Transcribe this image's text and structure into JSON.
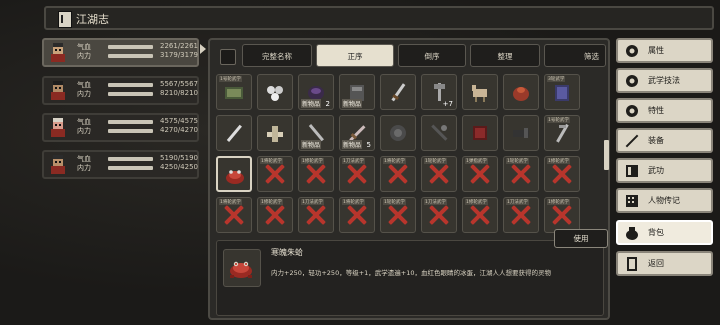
{
  "title": "江湖志",
  "party": [
    {
      "hp_label": "气血",
      "mp_label": "内力",
      "hp": "2261/2261",
      "mp": "3179/3179",
      "hp_frac": 1.0,
      "mp_frac": 1.0,
      "selected": true
    },
    {
      "hp_label": "气血",
      "mp_label": "内力",
      "hp": "5567/5567",
      "mp": "8210/8210",
      "hp_frac": 1.0,
      "mp_frac": 1.0,
      "selected": false
    },
    {
      "hp_label": "气血",
      "mp_label": "内力",
      "hp": "4575/4575",
      "mp": "4270/4270",
      "hp_frac": 1.0,
      "mp_frac": 1.0,
      "selected": false
    },
    {
      "hp_label": "气血",
      "mp_label": "内力",
      "hp": "5190/5190",
      "mp": "4250/4250",
      "hp_frac": 1.0,
      "mp_frac": 1.0,
      "selected": false
    }
  ],
  "toolbar": {
    "complete_name": "完整名称",
    "tabs": [
      "正序",
      "倒序",
      "整理",
      "筛选"
    ],
    "active_tab": 0
  },
  "inventory": {
    "row1": [
      {
        "tag": "1号轮武学",
        "count": "",
        "new": ""
      },
      {
        "tag": "",
        "count": "",
        "new": ""
      },
      {
        "tag": "",
        "count": "2",
        "new": "新物品"
      },
      {
        "tag": "",
        "count": "",
        "new": "新物品"
      },
      {
        "tag": "",
        "count": "",
        "new": ""
      },
      {
        "tag": "",
        "count": "+7",
        "new": ""
      },
      {
        "tag": "",
        "count": "",
        "new": ""
      },
      {
        "tag": "",
        "count": "",
        "new": ""
      },
      {
        "tag": "3轮武学",
        "count": "",
        "new": ""
      }
    ],
    "row2": [
      {
        "tag": "",
        "count": "",
        "new": ""
      },
      {
        "tag": "",
        "count": "",
        "new": ""
      },
      {
        "tag": "",
        "count": "",
        "new": "新物品"
      },
      {
        "tag": "",
        "count": "5",
        "new": "新物品"
      },
      {
        "tag": "",
        "count": "",
        "new": ""
      },
      {
        "tag": "",
        "count": "",
        "new": ""
      },
      {
        "tag": "",
        "count": "",
        "new": ""
      },
      {
        "tag": "",
        "count": "",
        "new": ""
      },
      {
        "tag": "1号轮武学",
        "count": "",
        "new": ""
      }
    ],
    "row3_tags": [
      "",
      "1将轮武学",
      "1修轮武学",
      "1刀法武学",
      "1将轮武学",
      "1轮轮武学",
      "1弹指武学",
      "1轮轮武学",
      "1修轮武学"
    ],
    "row4_tags": [
      "1将轮武学",
      "1修轮武学",
      "1刀法武学",
      "1将轮武学",
      "1轮轮武学",
      "1刀法武学",
      "1修轮武学",
      "1刀法武学",
      "1修轮武学"
    ]
  },
  "detail": {
    "name": "寒魄朱蛤",
    "desc": "内力+250，轻功+250，等级+1，武学遗遍+10，血红色眼睛的冰蛋，江湖人人想要获得的灵物"
  },
  "use_button": "使用",
  "menu": [
    {
      "label": "属性",
      "icon": "gear-icon"
    },
    {
      "label": "武学技法",
      "icon": "gear-icon"
    },
    {
      "label": "特性",
      "icon": "gear-icon"
    },
    {
      "label": "装备",
      "icon": "sword-icon"
    },
    {
      "label": "武功",
      "icon": "book-icon"
    },
    {
      "label": "人物传记",
      "icon": "grid-book-icon"
    },
    {
      "label": "背包",
      "icon": "bag-icon"
    },
    {
      "label": "返回",
      "icon": "door-icon"
    }
  ],
  "menu_active": 6,
  "colors": {
    "accent": "#e6e0cf",
    "red_mark": "#b8352c",
    "panel": "#2b2a27"
  }
}
